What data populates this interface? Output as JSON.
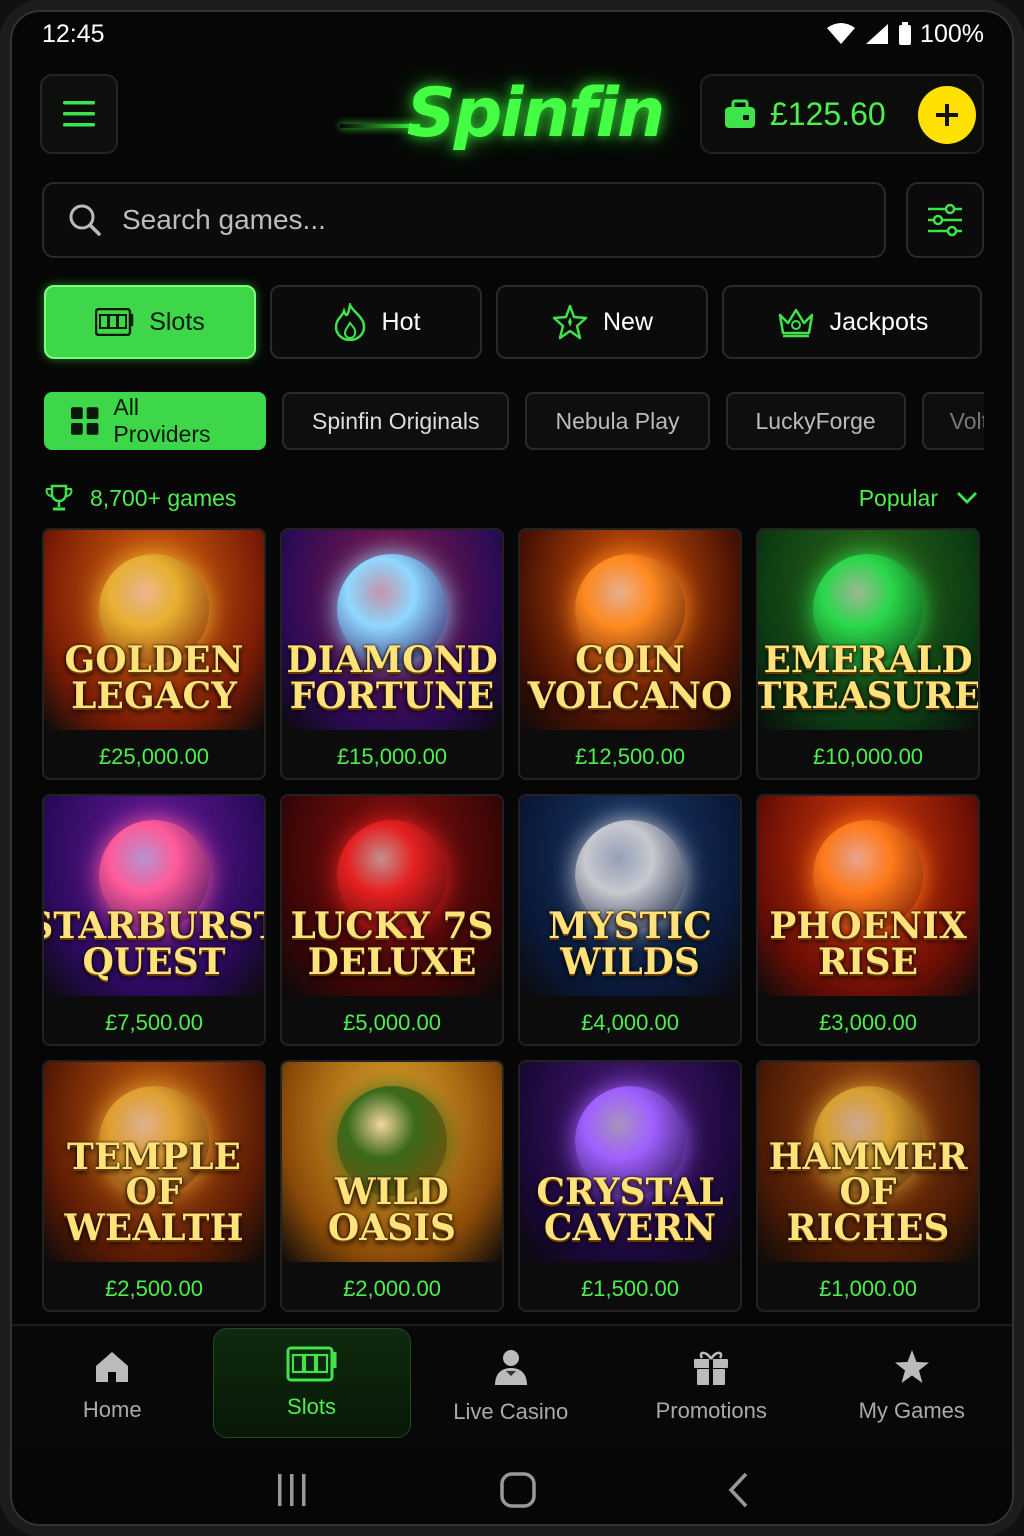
{
  "status": {
    "time": "12:45",
    "battery": "100%"
  },
  "header": {
    "logo": "Spinfin",
    "balance": "£125.60"
  },
  "search": {
    "placeholder": "Search games..."
  },
  "tabs": [
    {
      "label": "Slots",
      "icon": "slot-machine-icon",
      "active": true
    },
    {
      "label": "Hot",
      "icon": "flame-icon"
    },
    {
      "label": "New",
      "icon": "sparkle-star-icon"
    },
    {
      "label": "Jackpots",
      "icon": "crown-icon"
    }
  ],
  "providers": [
    {
      "label": "All Providers",
      "active": true
    },
    {
      "label": "Spinfin Originals"
    },
    {
      "label": "Nebula Play"
    },
    {
      "label": "LuckyForge"
    },
    {
      "label": "Volt"
    }
  ],
  "summary": {
    "count": "8,700+ games",
    "sort": "Popular"
  },
  "games": [
    {
      "title": "Golden Legacy",
      "prize": "£25,000.00",
      "bg": "#7a1c05",
      "bg2": "#e06a10",
      "emblem": "#e8b030"
    },
    {
      "title": "Diamond Fortune",
      "prize": "£15,000.00",
      "bg": "#2a0b55",
      "bg2": "#8a1a4a",
      "emblem": "#8fd8ff"
    },
    {
      "title": "Coin Volcano",
      "prize": "£12,500.00",
      "bg": "#4a1203",
      "bg2": "#e05a0a",
      "emblem": "#ff8a20"
    },
    {
      "title": "Emerald Treasure",
      "prize": "£10,000.00",
      "bg": "#0b3a12",
      "bg2": "#2f6a1a",
      "emblem": "#2bd84a"
    },
    {
      "title": "Starburst Quest",
      "prize": "£7,500.00",
      "bg": "#2a0a5a",
      "bg2": "#6a1aa0",
      "emblem": "#ff5a9a"
    },
    {
      "title": "Lucky 7s Deluxe",
      "prize": "£5,000.00",
      "bg": "#3a0606",
      "bg2": "#8a1010",
      "emblem": "#e52020"
    },
    {
      "title": "Mystic Wilds",
      "prize": "£4,000.00",
      "bg": "#0a1838",
      "bg2": "#1a3a6a",
      "emblem": "#c8c8d0"
    },
    {
      "title": "Phoenix Rise",
      "prize": "£3,000.00",
      "bg": "#6a0e05",
      "bg2": "#e0400a",
      "emblem": "#ff7a1a"
    },
    {
      "title": "Temple of Wealth",
      "prize": "£2,500.00",
      "bg": "#5a1a04",
      "bg2": "#c86010",
      "emblem": "#e0a030"
    },
    {
      "title": "Wild Oasis",
      "prize": "£2,000.00",
      "bg": "#8a4a08",
      "bg2": "#f0b030",
      "emblem": "#3a6a1a"
    },
    {
      "title": "Crystal Cavern",
      "prize": "£1,500.00",
      "bg": "#1a0838",
      "bg2": "#4a1a7a",
      "emblem": "#a060ff"
    },
    {
      "title": "Hammer of Riches",
      "prize": "£1,000.00",
      "bg": "#4a1a04",
      "bg2": "#a04810",
      "emblem": "#d8a030"
    }
  ],
  "nav": [
    {
      "label": "Home",
      "icon": "home-icon"
    },
    {
      "label": "Slots",
      "icon": "slot-machine-icon",
      "active": true
    },
    {
      "label": "Live Casino",
      "icon": "dealer-icon"
    },
    {
      "label": "Promotions",
      "icon": "gift-icon"
    },
    {
      "label": "My Games",
      "icon": "star-icon"
    }
  ],
  "colors": {
    "accent": "#3fd74a",
    "accent_text": "#4cf04c",
    "wallet_plus": "#ffe100",
    "background": "#060606"
  }
}
